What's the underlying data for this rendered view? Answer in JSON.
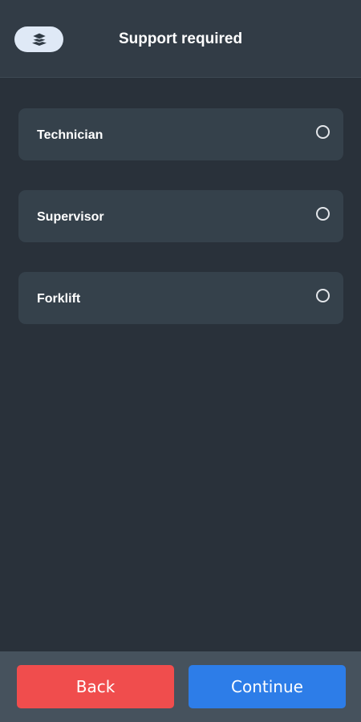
{
  "header": {
    "title": "Support required",
    "logo_icon": "layers-icon"
  },
  "options": [
    {
      "label": "Technician",
      "selected": false
    },
    {
      "label": "Supervisor",
      "selected": false
    },
    {
      "label": "Forklift",
      "selected": false
    }
  ],
  "footer": {
    "back_label": "Back",
    "continue_label": "Continue"
  },
  "colors": {
    "background": "#29313a",
    "header": "#323c46",
    "card": "#35414b",
    "footer": "#46525d",
    "back_button": "#f04d4d",
    "continue_button": "#2d7de8"
  }
}
